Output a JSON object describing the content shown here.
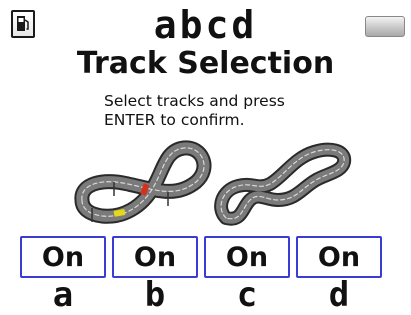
{
  "header": {
    "title": "abcd",
    "left_icon": "fuel-pump-icon",
    "right_icon": "battery-icon"
  },
  "screen": {
    "heading": "Track Selection",
    "instructions": [
      "Select tracks and press",
      "ENTER to confirm."
    ]
  },
  "tracks": [
    {
      "id": "track-a",
      "icon": "figure-eight-track-icon"
    },
    {
      "id": "track-b",
      "icon": "winding-track-icon"
    }
  ],
  "toggles": [
    {
      "label": "On",
      "lane": "a"
    },
    {
      "label": "On",
      "lane": "b"
    },
    {
      "label": "On",
      "lane": "c"
    },
    {
      "label": "On",
      "lane": "d"
    }
  ],
  "colors": {
    "button_border": "#3b3bd6",
    "track_surface": "#7a7a7a",
    "car_red": "#d2321e",
    "car_yellow": "#e3d81a"
  }
}
